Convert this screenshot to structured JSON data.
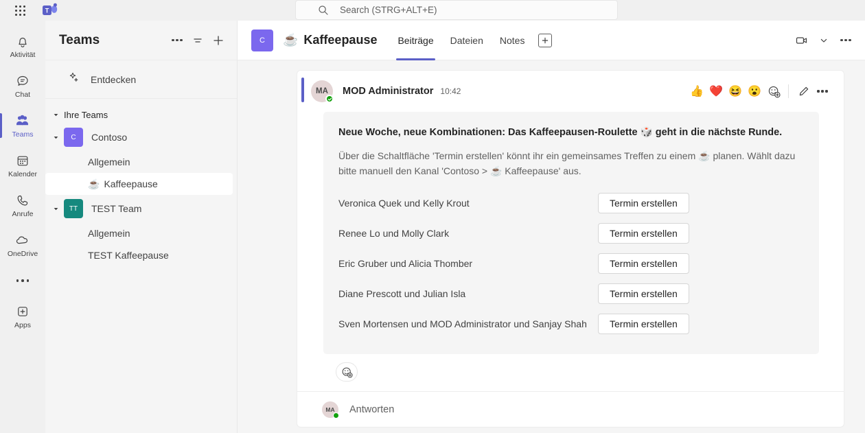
{
  "topbar": {
    "waffle_label": "app-launcher",
    "logo_label": "Microsoft Teams",
    "search": {
      "placeholder": "Search (STRG+ALT+E)",
      "icon": "search-icon"
    }
  },
  "rail": {
    "items": [
      {
        "label": "Aktivität",
        "icon": "bell-icon",
        "active": false
      },
      {
        "label": "Chat",
        "icon": "chat-icon",
        "active": false
      },
      {
        "label": "Teams",
        "icon": "teams-icon",
        "active": true
      },
      {
        "label": "Kalender",
        "icon": "calendar-icon",
        "active": false
      },
      {
        "label": "Anrufe",
        "icon": "phone-icon",
        "active": false
      },
      {
        "label": "OneDrive",
        "icon": "cloud-icon",
        "active": false
      }
    ],
    "more_label": "more-apps",
    "apps": {
      "label": "Apps",
      "icon": "plus-box-icon"
    }
  },
  "sidebar": {
    "title": "Teams",
    "actions": [
      {
        "name": "more-options",
        "icon": "ellipsis-icon"
      },
      {
        "name": "filter",
        "icon": "filter-icon"
      },
      {
        "name": "add-team",
        "icon": "plus-icon"
      }
    ],
    "discover": {
      "label": "Entdecken",
      "icon": "sparkle-icon"
    },
    "group_label": "Ihre Teams",
    "teams": [
      {
        "name": "Contoso",
        "initials": "C",
        "color": "#7b68ee",
        "channels": [
          {
            "name": "Allgemein",
            "emoji": "",
            "selected": false
          },
          {
            "name": "Kaffeepause",
            "emoji": "☕",
            "selected": true
          }
        ]
      },
      {
        "name": "TEST Team",
        "initials": "TT",
        "color": "#16897e",
        "channels": [
          {
            "name": "Allgemein",
            "emoji": "",
            "selected": false
          },
          {
            "name": "TEST Kaffeepause",
            "emoji": "",
            "selected": false
          }
        ]
      }
    ]
  },
  "channel": {
    "avatar_initials": "C",
    "avatar_color": "#7b68ee",
    "emoji": "☕",
    "title": "Kaffeepause",
    "tabs": [
      {
        "label": "Beiträge",
        "active": true
      },
      {
        "label": "Dateien",
        "active": false
      },
      {
        "label": "Notes",
        "active": false
      }
    ],
    "add_tab_icon": "plus-icon",
    "right_actions": [
      {
        "name": "meet-video",
        "icon": "video-camera-icon"
      },
      {
        "name": "meet-dropdown",
        "icon": "chevron-down-icon"
      },
      {
        "name": "channel-more",
        "icon": "ellipsis-icon"
      }
    ]
  },
  "message": {
    "avatar_initials": "MA",
    "author": "MOD Administrator",
    "time": "10:42",
    "presence": "available",
    "reactions": [
      {
        "name": "thumbs-up",
        "glyph": "👍"
      },
      {
        "name": "heart",
        "glyph": "❤️"
      },
      {
        "name": "laugh",
        "glyph": "😆"
      },
      {
        "name": "surprised",
        "glyph": "😮"
      }
    ],
    "actions": [
      {
        "name": "add-reaction",
        "icon": "add-reaction-icon"
      },
      {
        "name": "edit",
        "icon": "pencil-icon"
      },
      {
        "name": "more-options",
        "icon": "ellipsis-icon"
      }
    ],
    "card": {
      "title": "Neue Woche, neue Kombinationen: Das Kaffeepausen-Roulette 🎲 geht in die nächste Runde.",
      "subtitle": "Über die Schaltfläche 'Termin erstellen' könnt ihr ein gemeinsames Treffen zu einem ☕ planen. Wählt dazu bitte manuell den Kanal 'Contoso > ☕ Kaffeepause' aus.",
      "pairs": [
        {
          "names": "Veronica Quek und Kelly Krout",
          "button": "Termin erstellen"
        },
        {
          "names": "Renee Lo und Molly Clark",
          "button": "Termin erstellen"
        },
        {
          "names": "Eric Gruber und Alicia Thomber",
          "button": "Termin erstellen"
        },
        {
          "names": "Diane Prescott und Julian Isla",
          "button": "Termin erstellen"
        },
        {
          "names": "Sven Mortensen und MOD Administrator und Sanjay Shah",
          "button": "Termin erstellen"
        }
      ]
    },
    "add_reaction_icon": "add-reaction-icon",
    "reply": {
      "avatar_initials": "MA",
      "placeholder": "Antworten"
    }
  },
  "colors": {
    "accent": "#5b5fc7",
    "contoso": "#7b68ee",
    "test_team": "#16897e",
    "presence_green": "#13a10e",
    "card_bg": "#f5f5f5"
  }
}
